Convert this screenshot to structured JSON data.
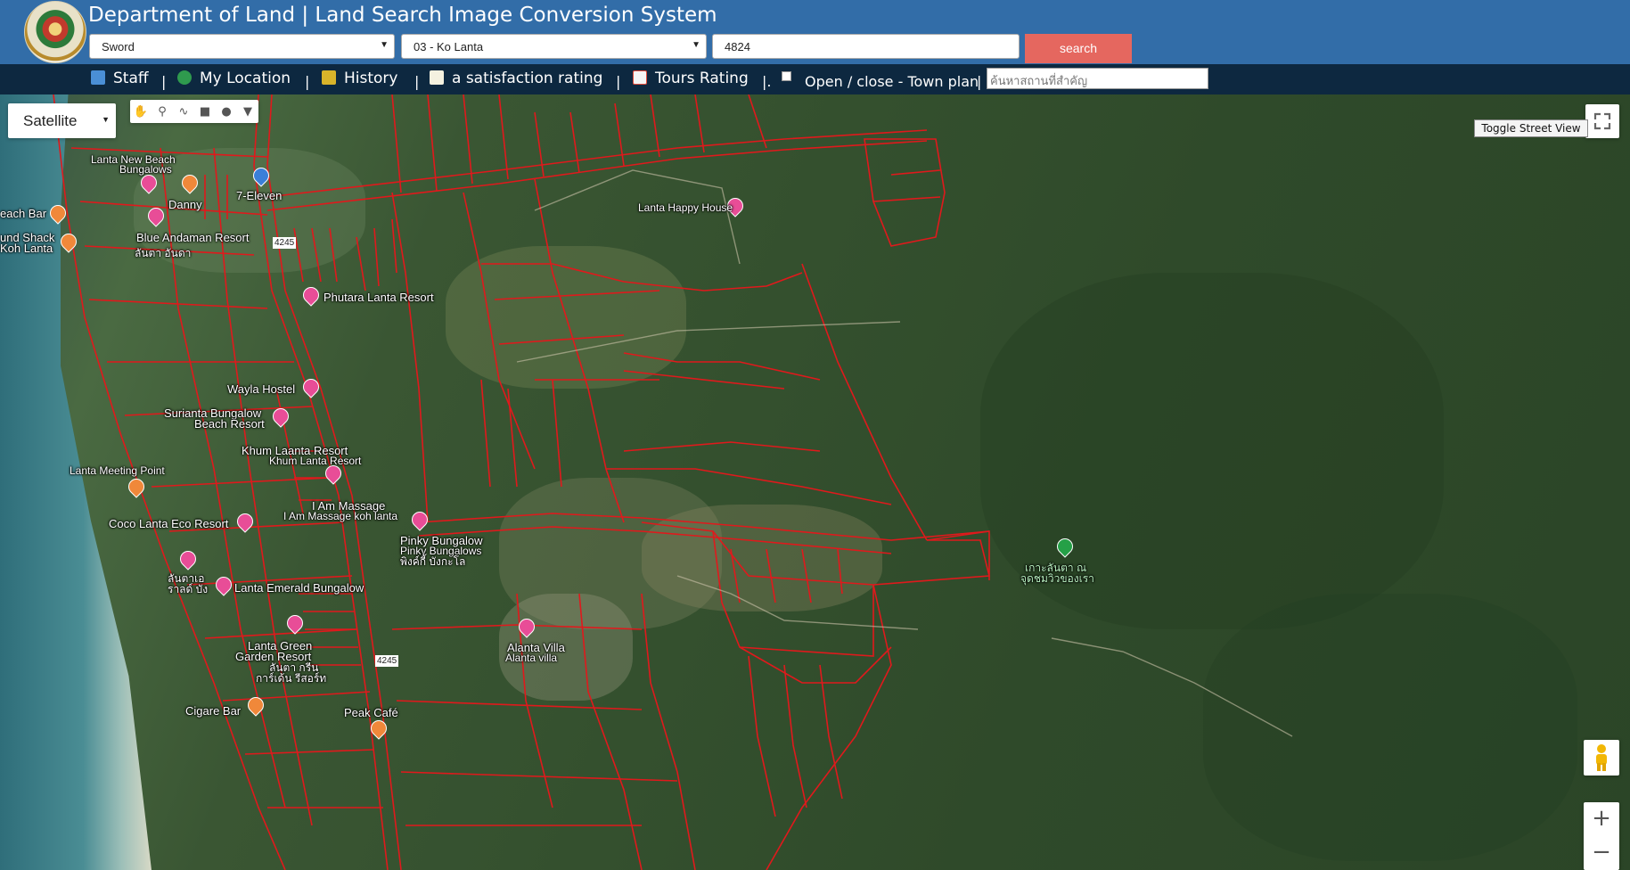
{
  "header": {
    "title": "Department of Land | Land Search Image Conversion System",
    "province_select": "Sword",
    "district_select": "03 - Ko Lanta",
    "parcel_number": "4824",
    "search_label": "search"
  },
  "nav": {
    "staff": "Staff",
    "my_location": "My Location",
    "history": "History",
    "satisfaction": "a satisfaction rating",
    "tours": "Tours Rating",
    "town_plan": "Open / close - Town plan",
    "separator": "|",
    "separator_dot": "|.",
    "place_placeholder": "ค้นหาสถานที่สำคัญ"
  },
  "map": {
    "map_type": "Satellite",
    "street_view": "Toggle Street View",
    "zoom_in": "+",
    "zoom_out": "−",
    "places": {
      "lanta_new_beach": "Lanta New Beach",
      "bungalows": "Bungalows",
      "danny": "Danny",
      "seven_eleven": "7-Eleven",
      "beach_bar": "each Bar",
      "sound_shack": "und Shack",
      "koh_lanta": "Koh Lanta",
      "blue_andaman": "Blue Andaman Resort",
      "blue_andaman_th": "ลันตา อันดา",
      "road_4245": "4245",
      "road_4245b": "4245",
      "lanta_happy_house": "Lanta Happy House",
      "phutara": "Phutara Lanta Resort",
      "wayla": "Wayla Hostel",
      "surianta": "Surianta Bungalow",
      "surianta2": "Beach Resort",
      "khum_laanta": "Khum Laanta Resort",
      "khum_laanta2": "Khum Lanta Resort",
      "lanta_meeting": "Lanta Meeting Point",
      "i_am_massage": "I Am Massage",
      "i_am_massage2": "I Am Massage koh lanta",
      "coco_lanta": "Coco Lanta Eco Resort",
      "pinky": "Pinky Bungalow",
      "pinky2": "Pinky Bungalows",
      "pinky3": "พิงค์กี้ บังกะโล",
      "lanta_emerald": "Lanta Emerald Bungalow",
      "emerald_th": "ลันตาเอ",
      "emerald_th2": "ราลด์ บัง",
      "alanta_villa": "Alanta Villa",
      "alanta_villa2": "Alanta villa",
      "lanta_green": "Lanta Green",
      "lanta_green2": "Garden Resort",
      "lanta_green_th": "ลันตา กรีน",
      "lanta_green_th2": "การ์เด้น รีสอร์ท",
      "cigare_bar": "Cigare Bar",
      "peak_cafe": "Peak Café",
      "ko_lanta_th": "เกาะลันตา ณ",
      "ko_lanta_th2": "จุดชมวิวของเรา"
    }
  }
}
